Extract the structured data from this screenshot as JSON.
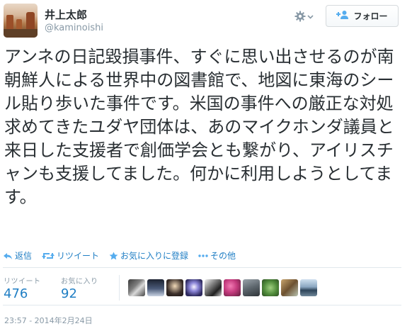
{
  "user": {
    "name": "井上太郎",
    "handle": "@kaminoishi"
  },
  "header": {
    "follow_label": "フォロー",
    "gear_icon": "gear-icon"
  },
  "tweet": {
    "text": "アンネの日記毀損事件、すぐに思い出させるのが南朝鮮人による世界中の図書館で、地図に東海のシール貼り歩いた事件です。米国の事件への厳正な対処求めてきたユダヤ団体は、あのマイクホンダ議員と来日した支援者で創価学会とも繋がり、アイリスチャンも支援してました。何かに利用しようとしてます。"
  },
  "actions": {
    "reply": "返信",
    "retweet": "リツイート",
    "favorite": "お気に入りに登録",
    "more": "その他"
  },
  "stats": {
    "retweets_label": "リツイート",
    "retweets_value": "476",
    "favorites_label": "お気に入り",
    "favorites_value": "92"
  },
  "timestamp": "23:57 - 2014年2月24日",
  "colors": {
    "link": "#1f7ec4",
    "muted": "#8899a6"
  }
}
